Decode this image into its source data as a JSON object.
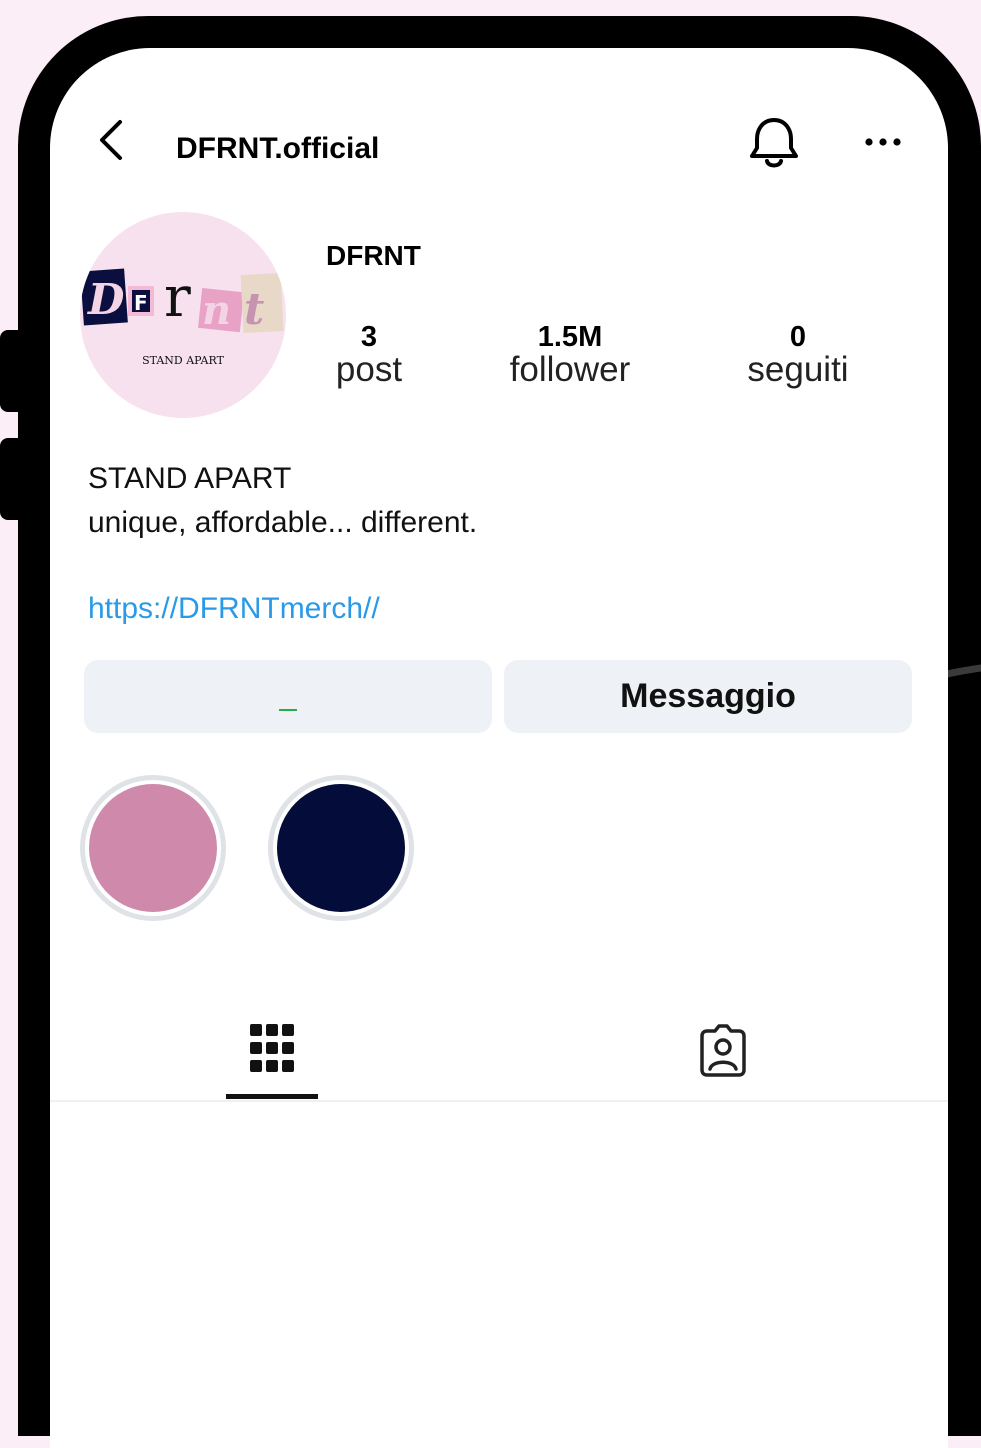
{
  "header": {
    "username": "DFRNT.official"
  },
  "profile": {
    "display_name": "DFRNT",
    "avatar_text": "STAND APART",
    "stats": [
      {
        "value": "3",
        "label": "post"
      },
      {
        "value": "1.5M",
        "label": "follower"
      },
      {
        "value": "0",
        "label": "seguiti"
      }
    ],
    "bio": {
      "line1": "STAND APART",
      "line2": "unique, affordable... different.",
      "link": "https://DFRNTmerch//"
    }
  },
  "buttons": {
    "message": "Messaggio"
  },
  "highlights": [
    {
      "color": "#cf8aab"
    },
    {
      "color": "#040c3a"
    }
  ],
  "tabs": [
    {
      "icon": "grid-icon",
      "active": true
    },
    {
      "icon": "tagged-user-icon",
      "active": false
    }
  ],
  "colors": {
    "background": "#fbeef6",
    "frame": "#000000",
    "link": "#2a9ae8",
    "button_bg": "#eef1f5"
  }
}
